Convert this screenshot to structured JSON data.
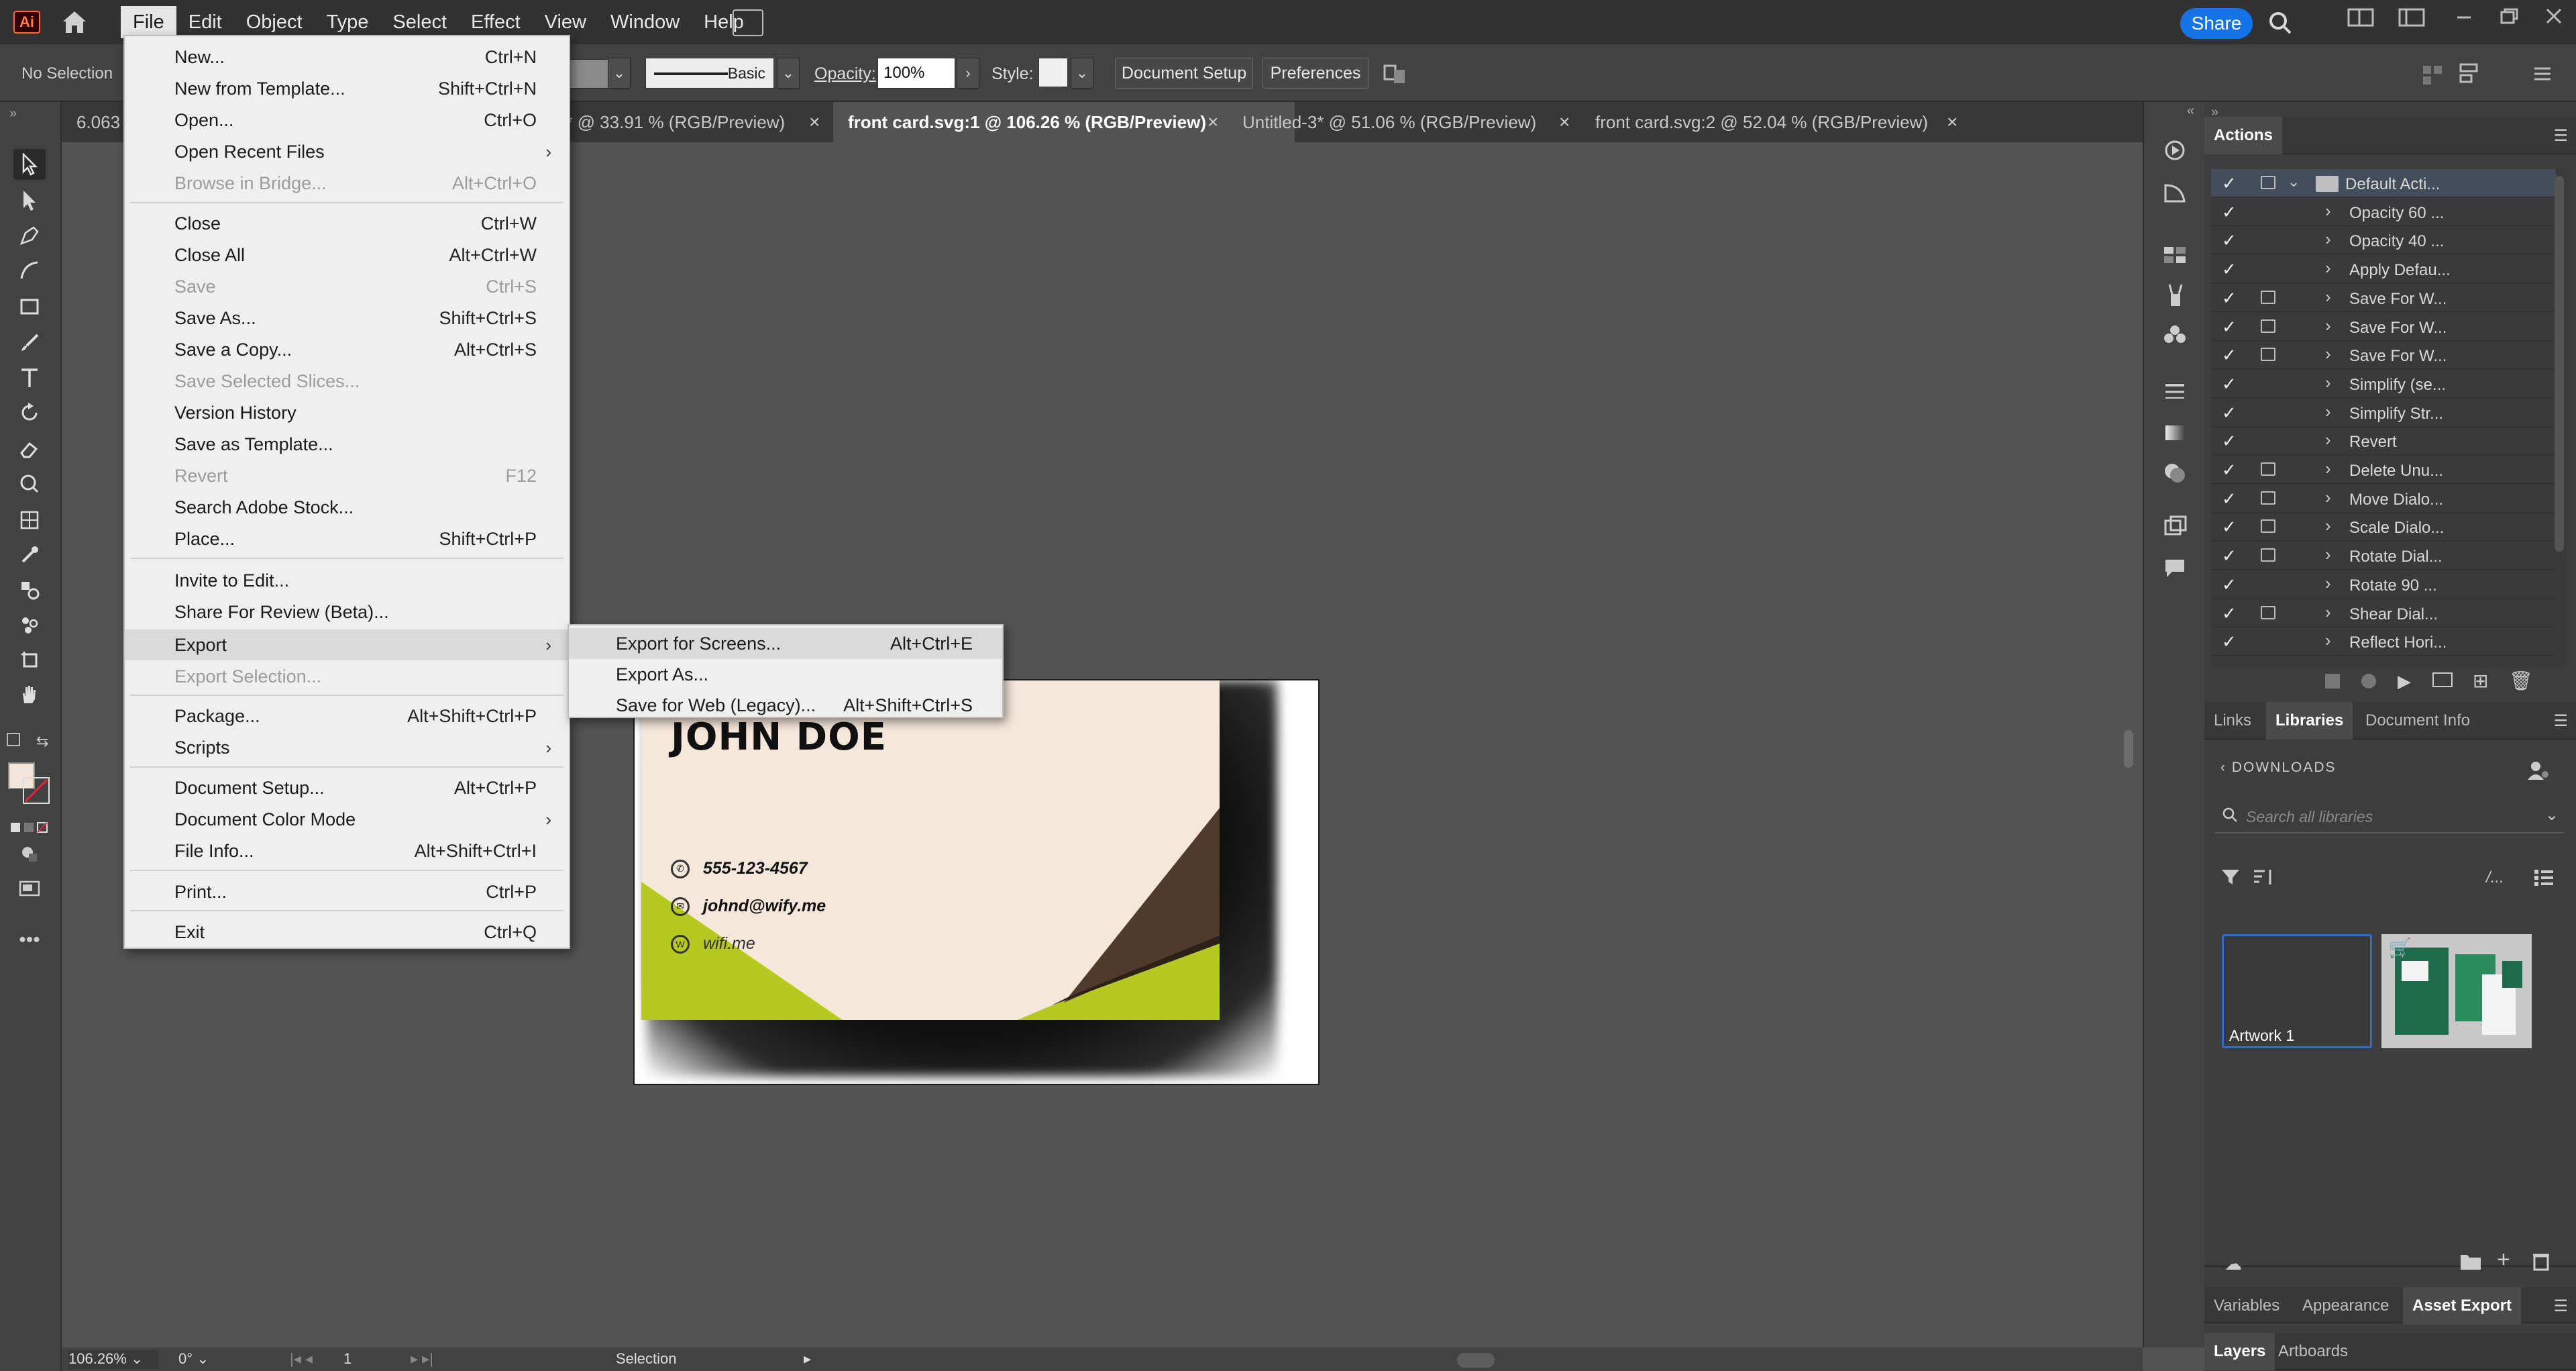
{
  "app": {
    "logo": "Ai"
  },
  "menubar": {
    "items": [
      "File",
      "Edit",
      "Object",
      "Type",
      "Select",
      "Effect",
      "View",
      "Window",
      "Help"
    ],
    "share_label": "Share"
  },
  "controlbar": {
    "selection_text": "No Selection",
    "stroke_profile": "Basic",
    "opacity_label": "Opacity:",
    "opacity_value": "100%",
    "style_label": "Style:",
    "document_setup": "Document Setup",
    "preferences": "Preferences"
  },
  "tabs": [
    {
      "label": "6.063",
      "close": false
    },
    {
      "label": "f* @ 33.91 % (RGB/Preview)",
      "close": true
    },
    {
      "label": "front card.svg:1 @ 106.26 % (RGB/Preview)",
      "close": true,
      "active": true
    },
    {
      "label": "Untitled-3* @ 51.06 % (RGB/Preview)",
      "close": true
    },
    {
      "label": "front card.svg:2 @ 52.04 % (RGB/Preview)",
      "close": true
    }
  ],
  "file_menu": {
    "items": [
      {
        "label": "New...",
        "shortcut": "Ctrl+N"
      },
      {
        "label": "New from Template...",
        "shortcut": "Shift+Ctrl+N"
      },
      {
        "label": "Open...",
        "shortcut": "Ctrl+O"
      },
      {
        "label": "Open Recent Files",
        "shortcut": "",
        "submenu": true
      },
      {
        "label": "Browse in Bridge...",
        "shortcut": "Alt+Ctrl+O",
        "disabled": true
      },
      {
        "label": "Close",
        "shortcut": "Ctrl+W"
      },
      {
        "label": "Close All",
        "shortcut": "Alt+Ctrl+W"
      },
      {
        "label": "Save",
        "shortcut": "Ctrl+S",
        "disabled": true
      },
      {
        "label": "Save As...",
        "shortcut": "Shift+Ctrl+S"
      },
      {
        "label": "Save a Copy...",
        "shortcut": "Alt+Ctrl+S"
      },
      {
        "label": "Save Selected Slices...",
        "shortcut": "",
        "disabled": true
      },
      {
        "label": "Version History",
        "shortcut": ""
      },
      {
        "label": "Save as Template...",
        "shortcut": ""
      },
      {
        "label": "Revert",
        "shortcut": "F12",
        "disabled": true
      },
      {
        "label": "Search Adobe Stock...",
        "shortcut": ""
      },
      {
        "label": "Place...",
        "shortcut": "Shift+Ctrl+P"
      },
      {
        "label": "Invite to Edit...",
        "shortcut": ""
      },
      {
        "label": "Share For Review (Beta)...",
        "shortcut": ""
      },
      {
        "label": "Export",
        "shortcut": "",
        "submenu": true,
        "highlighted": true
      },
      {
        "label": "Export Selection...",
        "shortcut": "",
        "disabled": true
      },
      {
        "label": "Package...",
        "shortcut": "Alt+Shift+Ctrl+P"
      },
      {
        "label": "Scripts",
        "shortcut": "",
        "submenu": true
      },
      {
        "label": "Document Setup...",
        "shortcut": "Alt+Ctrl+P"
      },
      {
        "label": "Document Color Mode",
        "shortcut": "",
        "submenu": true
      },
      {
        "label": "File Info...",
        "shortcut": "Alt+Shift+Ctrl+I"
      },
      {
        "label": "Print...",
        "shortcut": "Ctrl+P"
      },
      {
        "label": "Exit",
        "shortcut": "Ctrl+Q"
      }
    ]
  },
  "export_submenu": {
    "items": [
      {
        "label": "Export for Screens...",
        "shortcut": "Alt+Ctrl+E",
        "highlighted": true
      },
      {
        "label": "Export As...",
        "shortcut": ""
      },
      {
        "label": "Save for Web (Legacy)...",
        "shortcut": "Alt+Shift+Ctrl+S"
      }
    ]
  },
  "card": {
    "name": "JOHN DOE",
    "phone": "555-123-4567",
    "email": "johnd@wify.me",
    "web": "wifi.me",
    "colors": {
      "bg": "#f5e7da",
      "green": "#b5c920",
      "brown": "#4f3a2c"
    }
  },
  "actions_panel": {
    "title": "Actions",
    "set_name": "Default Acti...",
    "actions": [
      {
        "name": "Opacity 60 ...",
        "dialog": false
      },
      {
        "name": "Opacity 40 ...",
        "dialog": false
      },
      {
        "name": "Apply Defau...",
        "dialog": false
      },
      {
        "name": "Save For W...",
        "dialog": true
      },
      {
        "name": "Save For W...",
        "dialog": true
      },
      {
        "name": "Save For W...",
        "dialog": true
      },
      {
        "name": "Simplify (se...",
        "dialog": false
      },
      {
        "name": "Simplify Str...",
        "dialog": false
      },
      {
        "name": "Revert",
        "dialog": false
      },
      {
        "name": "Delete Unu...",
        "dialog": true
      },
      {
        "name": "Move Dialo...",
        "dialog": true
      },
      {
        "name": "Scale Dialo...",
        "dialog": true
      },
      {
        "name": "Rotate Dial...",
        "dialog": true
      },
      {
        "name": "Rotate 90 ...",
        "dialog": false
      },
      {
        "name": "Shear Dial...",
        "dialog": true
      },
      {
        "name": "Reflect Hori...",
        "dialog": false
      }
    ]
  },
  "libraries_panel": {
    "tabs": [
      "Links",
      "Libraries",
      "Document Info"
    ],
    "active_tab": "Libraries",
    "breadcrumb": "DOWNLOADS",
    "search_placeholder": "Search all libraries",
    "view_label": "/...",
    "tiles": [
      {
        "label": "Artwork 1"
      },
      {
        "label": ""
      }
    ]
  },
  "bottom_panel_tabs": [
    "Variables",
    "Appearance",
    "Asset Export"
  ],
  "bottom_panel_active": "Asset Export",
  "layers_tabs": [
    "Layers",
    "Artboards"
  ],
  "statusbar": {
    "zoom": "106.26%",
    "rotation": "0°",
    "artboard": "1",
    "tool": "Selection"
  }
}
